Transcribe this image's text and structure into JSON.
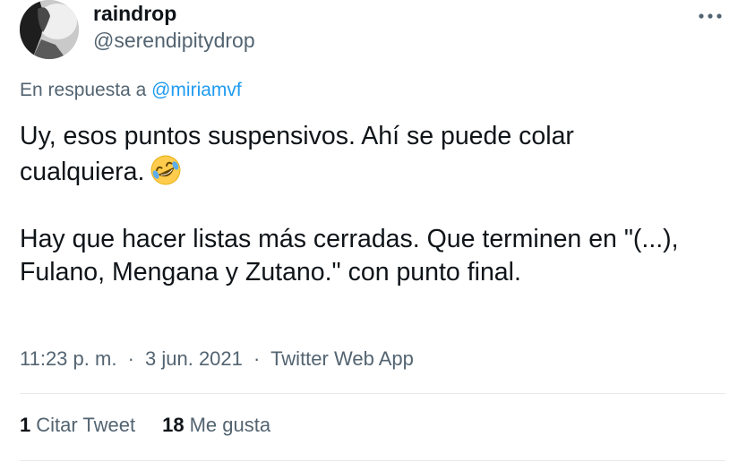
{
  "author": {
    "display_name": "raindrop",
    "handle": "@serendipitydrop"
  },
  "reply": {
    "prefix": "En respuesta a",
    "mention": "@miriamvf"
  },
  "body": {
    "paragraph1_line1": "Uy, esos puntos suspensivos. Ahí se puede colar",
    "paragraph1_line2": "cualquiera.",
    "emoji": "rolling-on-the-floor-laughing-emoji",
    "paragraph2": "Hay que hacer listas más cerradas. Que terminen en \"(...), Fulano, Mengana y Zutano.\" con punto final."
  },
  "meta": {
    "time": "11:23 p. m.",
    "separator": "·",
    "date": "3 jun. 2021",
    "source": "Twitter Web App"
  },
  "stats": {
    "quotes_count": "1",
    "quotes_label": "Citar Tweet",
    "likes_count": "18",
    "likes_label": "Me gusta"
  },
  "icons": {
    "more": "more-horizontal-icon"
  },
  "colors": {
    "text_primary": "#0f1419",
    "text_secondary": "#536471",
    "link": "#1d9bf0",
    "divider": "#e6eaed"
  }
}
